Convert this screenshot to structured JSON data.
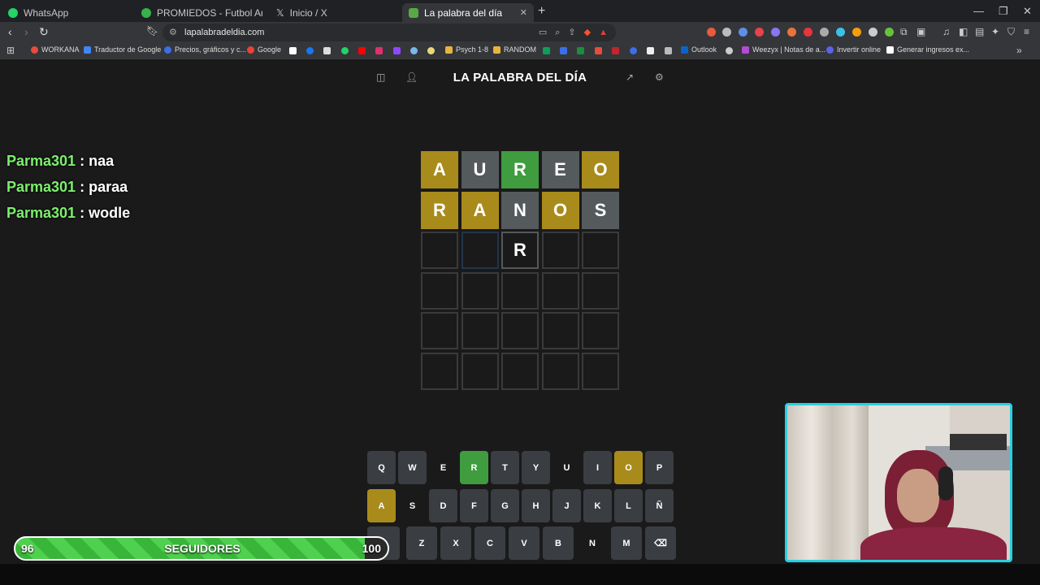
{
  "browser": {
    "tabs": [
      {
        "label": "WhatsApp",
        "color": "#25d366"
      },
      {
        "label": "PROMIEDOS - Futbol Argentino - Fi",
        "color": "#35b34a"
      },
      {
        "label": "Inicio / X",
        "color": "#ffffff"
      },
      {
        "label": "La palabra del día",
        "color": "#5aa845"
      }
    ],
    "url": "lapalabradeldia.com",
    "bookmarks": [
      {
        "label": "WORKANA",
        "color": "#e84c3d"
      },
      {
        "label": "Traductor de Google",
        "color": "#4285f4"
      },
      {
        "label": "Precios, gráficos y c...",
        "color": "#3b6ee8"
      },
      {
        "label": "Google",
        "color": "#ea4335"
      },
      {
        "label": "Psych 1-8",
        "color": "#e7b43c"
      },
      {
        "label": "RANDOM",
        "color": "#e7b43c"
      },
      {
        "label": "Outlook",
        "color": "#0a64c8"
      },
      {
        "label": "Weezyx | Notas de a...",
        "color": "#b44bd6"
      },
      {
        "label": "Invertir online",
        "color": "#5a64e8"
      },
      {
        "label": "Generar ingresos ex...",
        "color": "#ffffff"
      }
    ]
  },
  "game": {
    "title": "LA PALABRA DEL DÍA",
    "colors": {
      "green": "#3f9c3f",
      "yellow": "#a98b1c",
      "gray": "#555a5c",
      "keydefault": "#3a3d41"
    },
    "rows": [
      [
        {
          "l": "A",
          "s": "yellow"
        },
        {
          "l": "U",
          "s": "gray"
        },
        {
          "l": "R",
          "s": "green"
        },
        {
          "l": "E",
          "s": "gray"
        },
        {
          "l": "O",
          "s": "yellow"
        }
      ],
      [
        {
          "l": "R",
          "s": "yellow"
        },
        {
          "l": "A",
          "s": "yellow"
        },
        {
          "l": "N",
          "s": "gray"
        },
        {
          "l": "O",
          "s": "yellow"
        },
        {
          "l": "S",
          "s": "gray"
        }
      ],
      [
        {
          "l": "",
          "s": "empty"
        },
        {
          "l": "",
          "s": "current"
        },
        {
          "l": "R",
          "s": "typed"
        },
        {
          "l": "",
          "s": "empty"
        },
        {
          "l": "",
          "s": "empty"
        }
      ],
      [
        {
          "l": "",
          "s": "empty"
        },
        {
          "l": "",
          "s": "empty"
        },
        {
          "l": "",
          "s": "empty"
        },
        {
          "l": "",
          "s": "empty"
        },
        {
          "l": "",
          "s": "empty"
        }
      ],
      [
        {
          "l": "",
          "s": "empty"
        },
        {
          "l": "",
          "s": "empty"
        },
        {
          "l": "",
          "s": "empty"
        },
        {
          "l": "",
          "s": "empty"
        },
        {
          "l": "",
          "s": "empty"
        }
      ],
      [
        {
          "l": "",
          "s": "empty"
        },
        {
          "l": "",
          "s": "empty"
        },
        {
          "l": "",
          "s": "empty"
        },
        {
          "l": "",
          "s": "empty"
        },
        {
          "l": "",
          "s": "empty"
        }
      ]
    ],
    "keyboard": [
      [
        {
          "k": "Q",
          "s": "default"
        },
        {
          "k": "W",
          "s": "default"
        },
        {
          "k": "E",
          "s": "absent"
        },
        {
          "k": "R",
          "s": "green"
        },
        {
          "k": "T",
          "s": "default"
        },
        {
          "k": "Y",
          "s": "default"
        },
        {
          "k": "U",
          "s": "absent"
        },
        {
          "k": "I",
          "s": "default"
        },
        {
          "k": "O",
          "s": "yellow"
        },
        {
          "k": "P",
          "s": "default"
        }
      ],
      [
        {
          "k": "A",
          "s": "yellow"
        },
        {
          "k": "S",
          "s": "absent"
        },
        {
          "k": "D",
          "s": "default"
        },
        {
          "k": "F",
          "s": "default"
        },
        {
          "k": "G",
          "s": "default"
        },
        {
          "k": "H",
          "s": "default"
        },
        {
          "k": "J",
          "s": "default"
        },
        {
          "k": "K",
          "s": "default"
        },
        {
          "k": "L",
          "s": "default"
        },
        {
          "k": "Ñ",
          "s": "default"
        }
      ],
      [
        {
          "k": "Z",
          "s": "default"
        },
        {
          "k": "X",
          "s": "default"
        },
        {
          "k": "C",
          "s": "default"
        },
        {
          "k": "V",
          "s": "default"
        },
        {
          "k": "B",
          "s": "default"
        },
        {
          "k": "N",
          "s": "absent"
        },
        {
          "k": "M",
          "s": "default"
        },
        {
          "k": "⌫",
          "s": "default"
        }
      ]
    ]
  },
  "chat": [
    {
      "user": "Parma301",
      "msg": " : naa"
    },
    {
      "user": "Parma301",
      "msg": " : paraa"
    },
    {
      "user": "Parma301",
      "msg": " : wodle"
    }
  ],
  "followers": {
    "current": "96",
    "label": "SEGUIDORES",
    "goal": "100",
    "progress": 0.96
  }
}
